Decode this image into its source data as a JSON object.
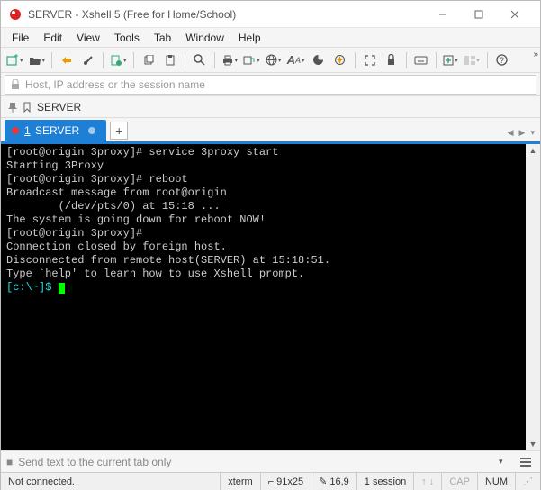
{
  "window": {
    "title": "SERVER - Xshell 5 (Free for Home/School)"
  },
  "menu": {
    "file": "File",
    "edit": "Edit",
    "view": "View",
    "tools": "Tools",
    "tab": "Tab",
    "window": "Window",
    "help": "Help"
  },
  "address": {
    "placeholder": "Host, IP address or the session name"
  },
  "session": {
    "name": "SERVER"
  },
  "tab": {
    "number": "1",
    "label": "SERVER"
  },
  "terminal": {
    "lines": [
      "[root@origin 3proxy]# service 3proxy start",
      "Starting 3Proxy",
      "",
      "[root@origin 3proxy]# reboot",
      "",
      "Broadcast message from root@origin",
      "        (/dev/pts/0) at 15:18 ...",
      "",
      "The system is going down for reboot NOW!",
      "[root@origin 3proxy]#",
      "Connection closed by foreign host.",
      "",
      "Disconnected from remote host(SERVER) at 15:18:51.",
      "",
      "Type `help' to learn how to use Xshell prompt."
    ],
    "prompt": "[c:\\~]$ "
  },
  "sendbar": {
    "placeholder": "Send text to the current tab only"
  },
  "status": {
    "connection": "Not connected.",
    "termtype": "xterm",
    "size": "91x25",
    "cursor": "16,9",
    "sessions": "1 session",
    "caps": "CAP",
    "num": "NUM"
  }
}
